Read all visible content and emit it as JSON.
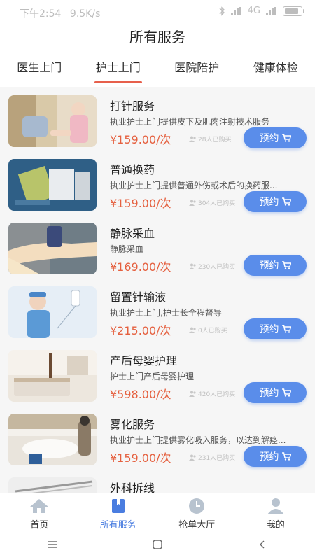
{
  "status_bar": {
    "time": "下午2:54",
    "speed": "9.5K/s",
    "network": "4G",
    "battery_fill": 0.85
  },
  "header": {
    "title": "所有服务"
  },
  "tabs": [
    {
      "label": "医生上门",
      "active": false
    },
    {
      "label": "护士上门",
      "active": true
    },
    {
      "label": "医院陪护",
      "active": false
    },
    {
      "label": "健康体检",
      "active": false
    }
  ],
  "services": [
    {
      "title": "打针服务",
      "desc": "执业护士上门提供皮下及肌肉注射技术服务",
      "price": "¥159.00/次",
      "bought": "28人已购买",
      "button": "预约",
      "thumb_icon": "injection-photo"
    },
    {
      "title": "普通换药",
      "desc": "执业护士上门提供普通外伤或术后的换药服...",
      "price": "¥159.00/次",
      "bought": "304人已购买",
      "button": "预约",
      "thumb_icon": "dressing-photo"
    },
    {
      "title": "静脉采血",
      "desc": "静脉采血",
      "price": "¥169.00/次",
      "bought": "230人已购买",
      "button": "预约",
      "thumb_icon": "blood-draw-photo"
    },
    {
      "title": "留置针输液",
      "desc": "执业护士上门,护士长全程督导",
      "price": "¥215.00/次",
      "bought": "0人已购买",
      "button": "预约",
      "thumb_icon": "infusion-photo"
    },
    {
      "title": "产后母婴护理",
      "desc": "护士上门产后母婴护理",
      "price": "¥598.00/次",
      "bought": "420人已购买",
      "button": "预约",
      "thumb_icon": "postpartum-room-photo"
    },
    {
      "title": "雾化服务",
      "desc": "执业护士上门提供雾化吸入服务，以达到解痉...",
      "price": "¥159.00/次",
      "bought": "231人已购买",
      "button": "预约",
      "thumb_icon": "nebulizer-photo"
    },
    {
      "title": "外科拆线",
      "desc": "",
      "price": "",
      "bought": "",
      "button": "",
      "thumb_icon": "suture-photo"
    }
  ],
  "bottom_nav": [
    {
      "label": "首页",
      "icon": "home-icon",
      "active": false
    },
    {
      "label": "所有服务",
      "icon": "services-icon",
      "active": true
    },
    {
      "label": "抢单大厅",
      "icon": "clock-icon",
      "active": false
    },
    {
      "label": "我的",
      "icon": "profile-icon",
      "active": false
    }
  ],
  "colors": {
    "accent": "#e7604c",
    "button": "#5a8dea",
    "price": "#e5603f",
    "nav_active": "#4a7de0"
  }
}
